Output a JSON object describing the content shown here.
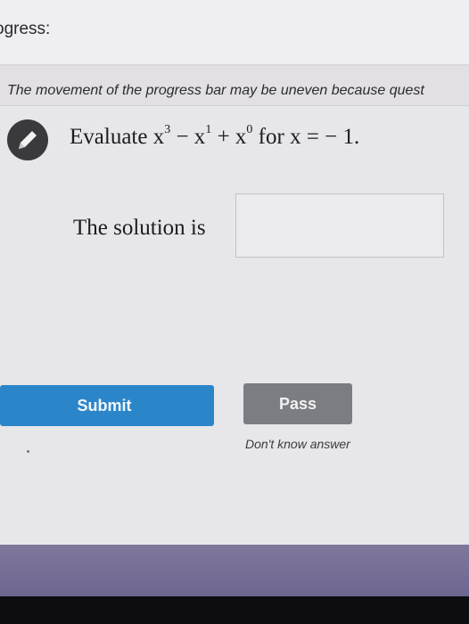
{
  "header": {
    "progress_label": "ogress:"
  },
  "notice": {
    "text": "The movement of the progress bar may be uneven because quest"
  },
  "question": {
    "prefix": "Evaluate x",
    "exp1": "3",
    "minus": " − x",
    "exp2": "1",
    "plus": " + x",
    "exp3": "0",
    "suffix": " for x =  − 1."
  },
  "answer": {
    "label": "The solution is",
    "value": "",
    "placeholder": ""
  },
  "actions": {
    "submit_label": "Submit",
    "pass_label": "Pass",
    "dont_know_label": "Don't know answer"
  },
  "colors": {
    "submit": "#2b86c9",
    "pass": "#7c7d82",
    "footer": "#7f779b"
  },
  "icons": {
    "badge": "pencil-icon"
  }
}
